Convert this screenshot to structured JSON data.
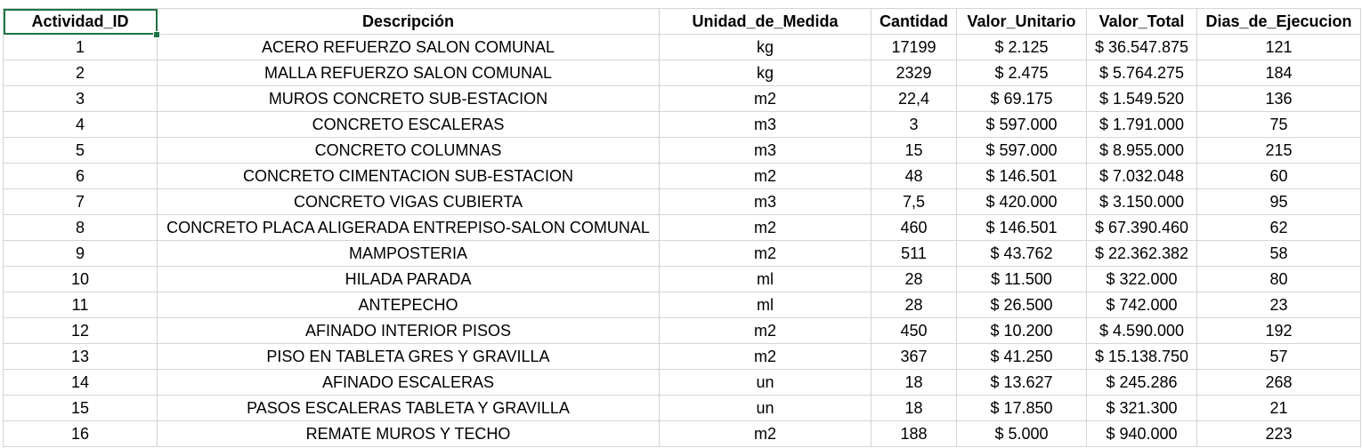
{
  "headers": {
    "id": "Actividad_ID",
    "desc": "Descripción",
    "unit": "Unidad_de_Medida",
    "qty": "Cantidad",
    "unit_value": "Valor_Unitario",
    "total": "Valor_Total",
    "days": "Dias_de_Ejecucion"
  },
  "rows": [
    {
      "id": "1",
      "desc": "ACERO REFUERZO SALON COMUNAL",
      "unit": "kg",
      "qty": "17199",
      "unit_value": "$ 2.125",
      "total": "$ 36.547.875",
      "days": "121"
    },
    {
      "id": "2",
      "desc": "MALLA REFUERZO SALON COMUNAL",
      "unit": "kg",
      "qty": "2329",
      "unit_value": "$ 2.475",
      "total": "$ 5.764.275",
      "days": "184"
    },
    {
      "id": "3",
      "desc": "MUROS CONCRETO SUB-ESTACION",
      "unit": "m2",
      "qty": "22,4",
      "unit_value": "$ 69.175",
      "total": "$ 1.549.520",
      "days": "136"
    },
    {
      "id": "4",
      "desc": "CONCRETO ESCALERAS",
      "unit": "m3",
      "qty": "3",
      "unit_value": "$ 597.000",
      "total": "$ 1.791.000",
      "days": "75"
    },
    {
      "id": "5",
      "desc": "CONCRETO COLUMNAS",
      "unit": "m3",
      "qty": "15",
      "unit_value": "$ 597.000",
      "total": "$ 8.955.000",
      "days": "215"
    },
    {
      "id": "6",
      "desc": "CONCRETO CIMENTACION SUB-ESTACION",
      "unit": "m2",
      "qty": "48",
      "unit_value": "$ 146.501",
      "total": "$ 7.032.048",
      "days": "60"
    },
    {
      "id": "7",
      "desc": "CONCRETO VIGAS CUBIERTA",
      "unit": "m3",
      "qty": "7,5",
      "unit_value": "$ 420.000",
      "total": "$ 3.150.000",
      "days": "95"
    },
    {
      "id": "8",
      "desc": "CONCRETO PLACA ALIGERADA ENTREPISO-SALON COMUNAL",
      "unit": "m2",
      "qty": "460",
      "unit_value": "$ 146.501",
      "total": "$ 67.390.460",
      "days": "62"
    },
    {
      "id": "9",
      "desc": "MAMPOSTERIA",
      "unit": "m2",
      "qty": "511",
      "unit_value": "$ 43.762",
      "total": "$ 22.362.382",
      "days": "58"
    },
    {
      "id": "10",
      "desc": "HILADA PARADA",
      "unit": "ml",
      "qty": "28",
      "unit_value": "$ 11.500",
      "total": "$ 322.000",
      "days": "80"
    },
    {
      "id": "11",
      "desc": "ANTEPECHO",
      "unit": "ml",
      "qty": "28",
      "unit_value": "$ 26.500",
      "total": "$ 742.000",
      "days": "23"
    },
    {
      "id": "12",
      "desc": "AFINADO INTERIOR PISOS",
      "unit": "m2",
      "qty": "450",
      "unit_value": "$ 10.200",
      "total": "$ 4.590.000",
      "days": "192"
    },
    {
      "id": "13",
      "desc": "PISO EN TABLETA GRES Y GRAVILLA",
      "unit": "m2",
      "qty": "367",
      "unit_value": "$ 41.250",
      "total": "$ 15.138.750",
      "days": "57"
    },
    {
      "id": "14",
      "desc": "AFINADO ESCALERAS",
      "unit": "un",
      "qty": "18",
      "unit_value": "$ 13.627",
      "total": "$ 245.286",
      "days": "268"
    },
    {
      "id": "15",
      "desc": "PASOS ESCALERAS TABLETA Y GRAVILLA",
      "unit": "un",
      "qty": "18",
      "unit_value": "$ 17.850",
      "total": "$ 321.300",
      "days": "21"
    },
    {
      "id": "16",
      "desc": "REMATE MUROS Y TECHO",
      "unit": "m2",
      "qty": "188",
      "unit_value": "$ 5.000",
      "total": "$ 940.000",
      "days": "223"
    }
  ],
  "colors": {
    "selection": "#1f7244",
    "gridline": "#d4d4d4"
  }
}
